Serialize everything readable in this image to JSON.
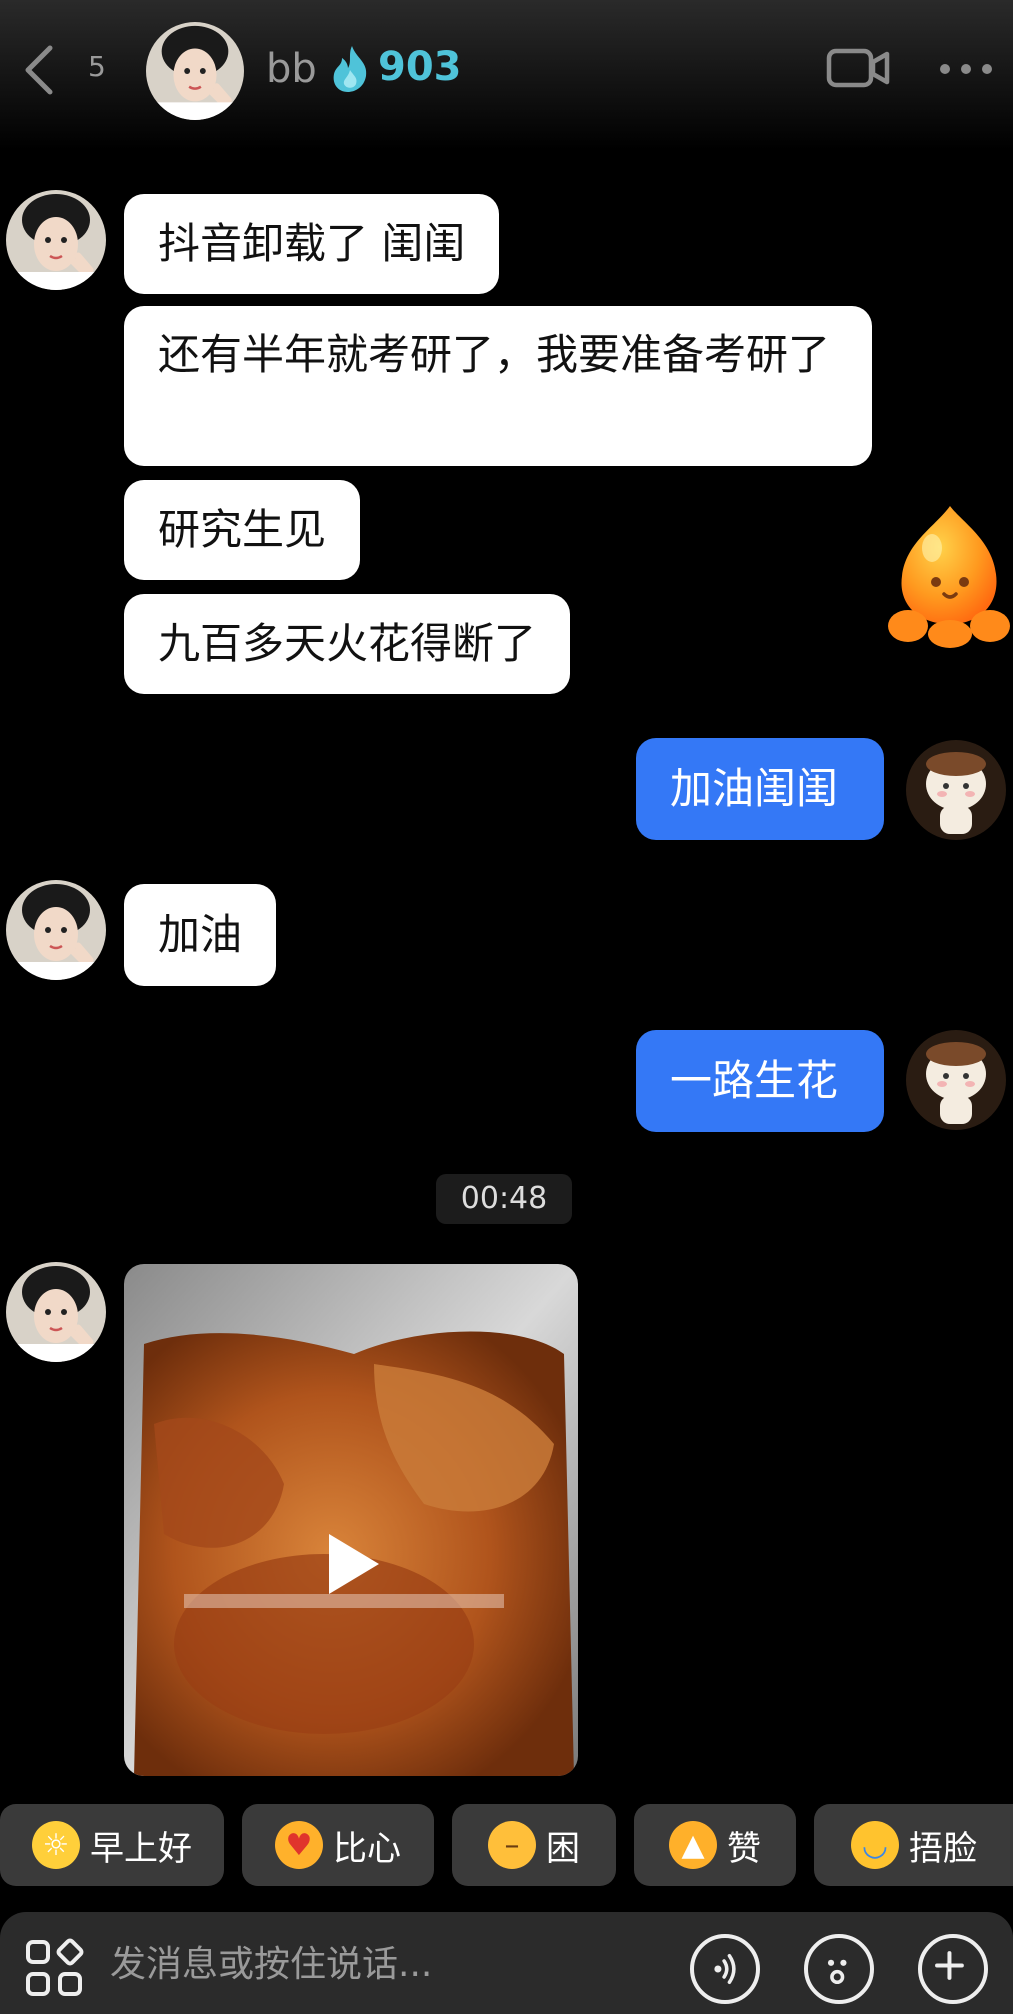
{
  "header": {
    "unread_count": "5",
    "contact_name": "bb",
    "streak_count": "903"
  },
  "messages": [
    {
      "side": "in",
      "text": "抖音卸载了 闺闺"
    },
    {
      "side": "in",
      "text": "还有半年就考研了，我要准备考研了"
    },
    {
      "side": "in",
      "text": "研究生见"
    },
    {
      "side": "in",
      "text": "九百多天火花得断了"
    },
    {
      "side": "out",
      "text": "加油闺闺"
    },
    {
      "side": "in",
      "text": "加油"
    },
    {
      "side": "out",
      "text": "一路生花"
    }
  ],
  "timestamp": "00:48",
  "quick_replies": [
    {
      "label": "早上好",
      "icon": "sun-glasses-emoji"
    },
    {
      "label": "比心",
      "icon": "heart-hands-emoji"
    },
    {
      "label": "困",
      "icon": "sleepy-face-emoji"
    },
    {
      "label": "赞",
      "icon": "thumbs-up-emoji"
    },
    {
      "label": "捂脸",
      "icon": "facepalm-emoji"
    }
  ],
  "input": {
    "placeholder": "发消息或按住说话..."
  },
  "colors": {
    "outgoing_bubble": "#3478f6",
    "incoming_bubble": "#ffffff",
    "streak": "#4fc3d9"
  }
}
